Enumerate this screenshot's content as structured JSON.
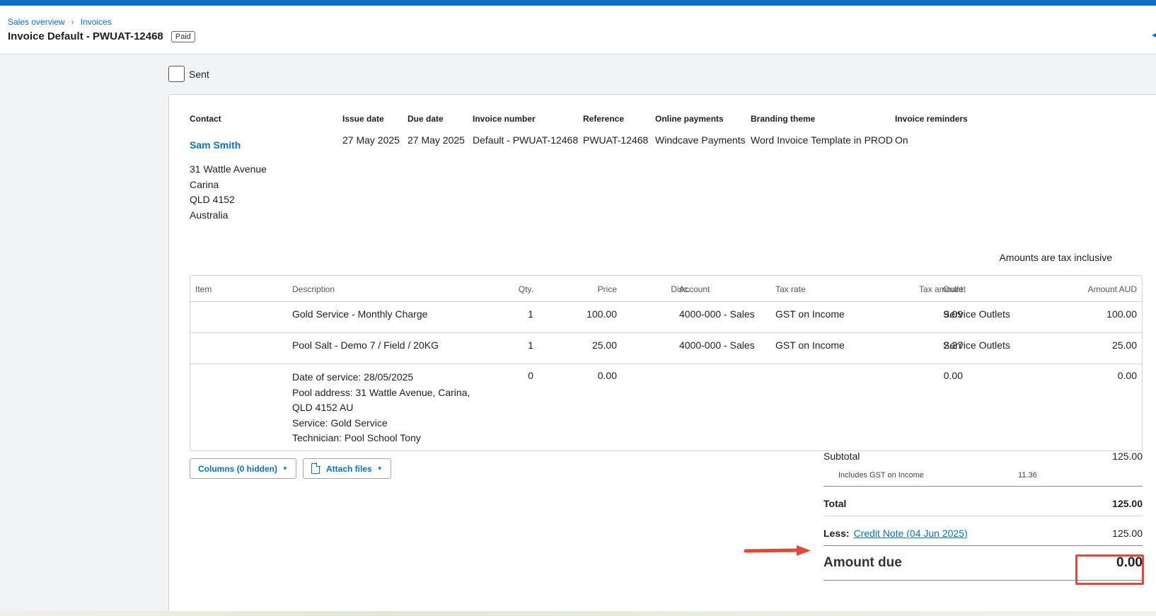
{
  "breadcrumb": {
    "items": [
      "Sales overview",
      "Invoices"
    ],
    "separator": "›"
  },
  "title": "Invoice Default - PWUAT-12468",
  "status_badge": "Paid",
  "sent": {
    "label": "Sent",
    "checked": false
  },
  "contact": {
    "label": "Contact",
    "name": "Sam Smith",
    "address_lines": [
      "31 Wattle Avenue",
      "Carina",
      "QLD 4152",
      "Australia"
    ]
  },
  "details": [
    {
      "label": "Issue date",
      "value": "27 May 2025"
    },
    {
      "label": "Due date",
      "value": "27 May 2025"
    },
    {
      "label": "Invoice number",
      "value": "Default - PWUAT-12468"
    },
    {
      "label": "Reference",
      "value": "PWUAT-12468"
    },
    {
      "label": "Online payments",
      "value": "Windcave Payments"
    },
    {
      "label": "Branding theme",
      "value": "Word Invoice Template in PROD"
    },
    {
      "label": "Invoice reminders",
      "value": "On"
    }
  ],
  "tax_note": "Amounts are tax inclusive",
  "table": {
    "columns": [
      "Item",
      "Description",
      "Qty.",
      "Price",
      "Disc.",
      "Account",
      "Tax rate",
      "Tax amount",
      "Outlet",
      "Amount AUD"
    ],
    "rows": [
      {
        "item": "",
        "description": [
          "Gold Service - Monthly Charge"
        ],
        "qty": "1",
        "price": "100.00",
        "disc": "",
        "account": "4000-000 - Sales",
        "tax_rate": "GST on Income",
        "tax_amount": "9.09",
        "outlet": "Service Outlets",
        "amount": "100.00"
      },
      {
        "item": "",
        "description": [
          "Pool Salt - Demo 7 / Field / 20KG"
        ],
        "qty": "1",
        "price": "25.00",
        "disc": "",
        "account": "4000-000 - Sales",
        "tax_rate": "GST on Income",
        "tax_amount": "2.27",
        "outlet": "Service Outlets",
        "amount": "25.00"
      },
      {
        "item": "",
        "description": [
          "Date of service: 28/05/2025",
          "Pool address: 31 Wattle Avenue, Carina,",
          "QLD 4152 AU",
          "Service: Gold Service",
          "Technician: Pool School Tony"
        ],
        "qty": "0",
        "price": "0.00",
        "disc": "",
        "account": "",
        "tax_rate": "",
        "tax_amount": "0.00",
        "outlet": "",
        "amount": "0.00"
      }
    ]
  },
  "buttons": {
    "columns": "Columns (0 hidden)",
    "attach": "Attach files"
  },
  "totals": {
    "subtotal_label": "Subtotal",
    "subtotal": "125.00",
    "gst_label": "Includes GST on Income",
    "gst": "11.36",
    "total_label": "Total",
    "total": "125.00",
    "less_label": "Less:",
    "credit_note": "Credit Note (04 Jun 2025)",
    "less_value": "125.00",
    "amount_due_label": "Amount due",
    "amount_due": "0.00"
  },
  "colors": {
    "accent": "#0a6fc2",
    "highlight": "#e0493a"
  }
}
